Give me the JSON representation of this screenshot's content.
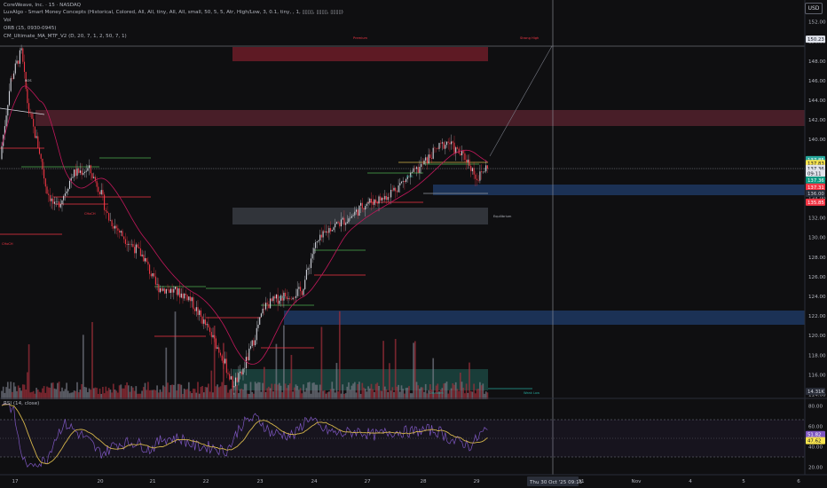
{
  "header": {
    "symbol_line": "CoreWeave, Inc. · 15 · NASDAQ",
    "indicators": [
      "LuxAlgo - Smart Money Concepts (Historical, Colored, All, All, tiny, All, All, small, 50, 5, 5, Atr, High/Low, 3, 0.1, tiny, , 1, ▯▯▯▯, ▯▯▯▯, ▯▯▯▯)",
      "Vol",
      "ORB (15, 0930-0945)",
      "CM_Ultimate_MA_MTF_V2 (D, 20, 7, 1, 2, 50, 7, 1)"
    ],
    "currency_button": "USD"
  },
  "price_axis": {
    "ticks": [
      "152.00",
      "150.00",
      "148.00",
      "146.00",
      "144.00",
      "142.00",
      "140.00",
      "138.00",
      "136.00",
      "134.00",
      "132.00",
      "130.00",
      "128.00",
      "126.00",
      "124.00",
      "122.00",
      "120.00",
      "118.00",
      "116.00",
      "114.00"
    ],
    "min": 113.5,
    "max": 153.5,
    "badges": [
      {
        "text": "150.23",
        "value": 150.23,
        "bg": "#e0e3eb",
        "fg": "#131722"
      },
      {
        "text": "137.85",
        "value": 137.95,
        "bg": "#26a69a",
        "fg": "#ffffff"
      },
      {
        "text": "137.83",
        "value": 137.55,
        "bg": "#f7e34e",
        "fg": "#131722"
      },
      {
        "text": "137.36",
        "value": 137.05,
        "bg": "#e0e3eb",
        "fg": "#131722"
      },
      {
        "text": "09:11",
        "value": 136.55,
        "bg": "#e0e3eb",
        "fg": "#131722"
      },
      {
        "text": "137.36",
        "value": 135.85,
        "bg": "#089981",
        "fg": "#ffffff"
      },
      {
        "text": "137.31",
        "value": 135.15,
        "bg": "#f23645",
        "fg": "#ffffff"
      },
      {
        "text": "136.00",
        "value": 134.5,
        "bg": "#2a2e39",
        "fg": "#d1d4dc"
      },
      {
        "text": "135.85",
        "value": 133.6,
        "bg": "#f23645",
        "fg": "#ffffff"
      },
      {
        "text": "14.31K",
        "value": 114.3,
        "bg": "#2a2e39",
        "fg": "#d1d4dc"
      }
    ]
  },
  "annotations": {
    "premium": "Premium",
    "equilibrium": "Equilibrium",
    "discount": "Discount",
    "strong_high": "Strong High",
    "weak_low": "Weak Low",
    "bos": "BOS",
    "choch": "CHoCH"
  },
  "rsi": {
    "label": "RSI (14, close)",
    "ticks": [
      "80.00",
      "60.00",
      "40.00",
      "20.00"
    ],
    "min": 15,
    "max": 85,
    "badges": [
      {
        "text": "51.82",
        "value": 52,
        "bg": "#7e57c2",
        "fg": "#ffffff"
      },
      {
        "text": "47.62",
        "value": 46,
        "bg": "#f7e34e",
        "fg": "#131722"
      }
    ]
  },
  "time_axis": {
    "ticks": [
      "17",
      "20",
      "21",
      "22",
      "23",
      "24",
      "27",
      "28",
      "29",
      "31",
      "Nov",
      "4",
      "5",
      "6"
    ],
    "cursor_label": "Thu 30 Oct '25",
    "cursor_time": "09:15"
  },
  "colors": {
    "background": "#0f0f11",
    "up": "#d1d4dc",
    "down": "#f23645",
    "bull_line": "#4caf50",
    "bear_line": "#f23645",
    "ma": "#c2185b",
    "rsi": "#7e57c2",
    "rsi_ma": "#d4b44a"
  }
}
